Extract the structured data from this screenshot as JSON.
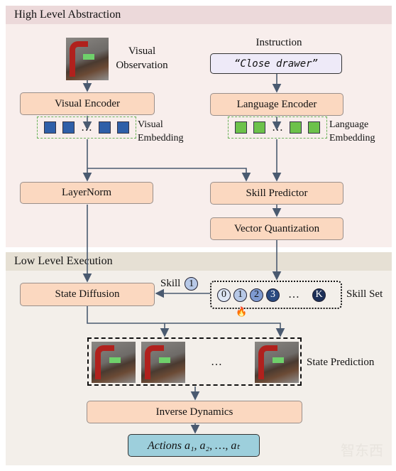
{
  "high_level": {
    "title": "High Level Abstraction",
    "visual_observation_label": [
      "Visual",
      "Observation"
    ],
    "instruction_label": "Instruction",
    "instruction_text": "“Close drawer”",
    "visual_encoder": "Visual Encoder",
    "language_encoder": "Language Encoder",
    "visual_embedding_label": [
      "Visual",
      "Embedding"
    ],
    "language_embedding_label": [
      "Language",
      "Embedding"
    ],
    "embedding_ellipsis": "…",
    "layernorm": "LayerNorm",
    "skill_predictor": "Skill Predictor",
    "vector_quantization": "Vector Quantization"
  },
  "low_level": {
    "title": "Low Level Execution",
    "state_diffusion": "State Diffusion",
    "selected_skill_label": "Skill",
    "selected_skill": "1",
    "skill_set_label": "Skill Set",
    "skills": [
      "0",
      "1",
      "2",
      "3",
      "…",
      "K"
    ],
    "prediction_ellipsis": "…",
    "state_prediction_label": "State Prediction",
    "inverse_dynamics": "Inverse Dynamics",
    "actions": "Actions a₁, a₂, …, aₜ"
  },
  "watermark": "智东西",
  "colors": {
    "encoder_box": "#fbd8c0",
    "actions_box": "#9dcfdc",
    "high_bg": "#f8eeec",
    "low_bg": "#f3efea"
  }
}
